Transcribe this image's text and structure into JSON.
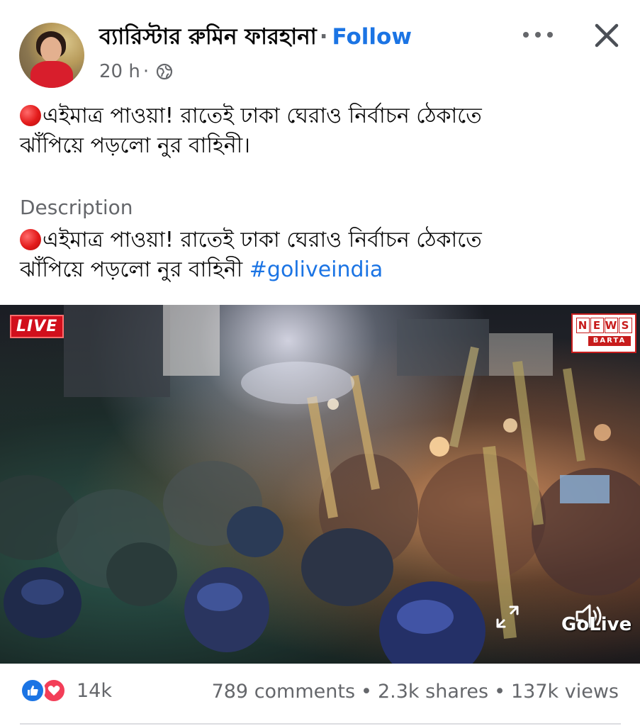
{
  "header": {
    "author_name": "ব্যারিস্টার রুমিন ফারহানা",
    "separator": "·",
    "follow_label": "Follow",
    "time": "20 h",
    "meta_separator": "·"
  },
  "post": {
    "text_line1": "এইমাত্র পাওয়া! রাতেই ঢাকা ঘেরাও নির্বাচন ঠেকাতে",
    "text_line2": "ঝাঁপিয়ে পড়লো নুর বাহিনী।",
    "description_label": "Description",
    "description_line1": "এইমাত্র পাওয়া! রাতেই ঢাকা ঘেরাও নির্বাচন ঠেকাতে",
    "description_line2": "ঝাঁপিয়ে পড়লো নুর বাহিনী",
    "hashtag": "#goliveindia"
  },
  "video": {
    "live_badge": "LIVE",
    "logo_letters": [
      "N",
      "E",
      "W",
      "S"
    ],
    "logo_sub": "BARTA",
    "watermark": "GoLive"
  },
  "footer": {
    "reaction_count": "14k",
    "comments": "789 comments",
    "shares": "2.3k shares",
    "views": "137k views",
    "stat_separator": "•"
  },
  "colors": {
    "link": "#1b74e4",
    "muted": "#65676b",
    "like": "#1b74e4",
    "love": "#f33e58",
    "live": "#d10f1c"
  },
  "icons": [
    "globe-icon",
    "more-icon",
    "close-icon",
    "red-circle-icon",
    "expand-icon",
    "volume-icon",
    "like-icon",
    "love-icon"
  ]
}
